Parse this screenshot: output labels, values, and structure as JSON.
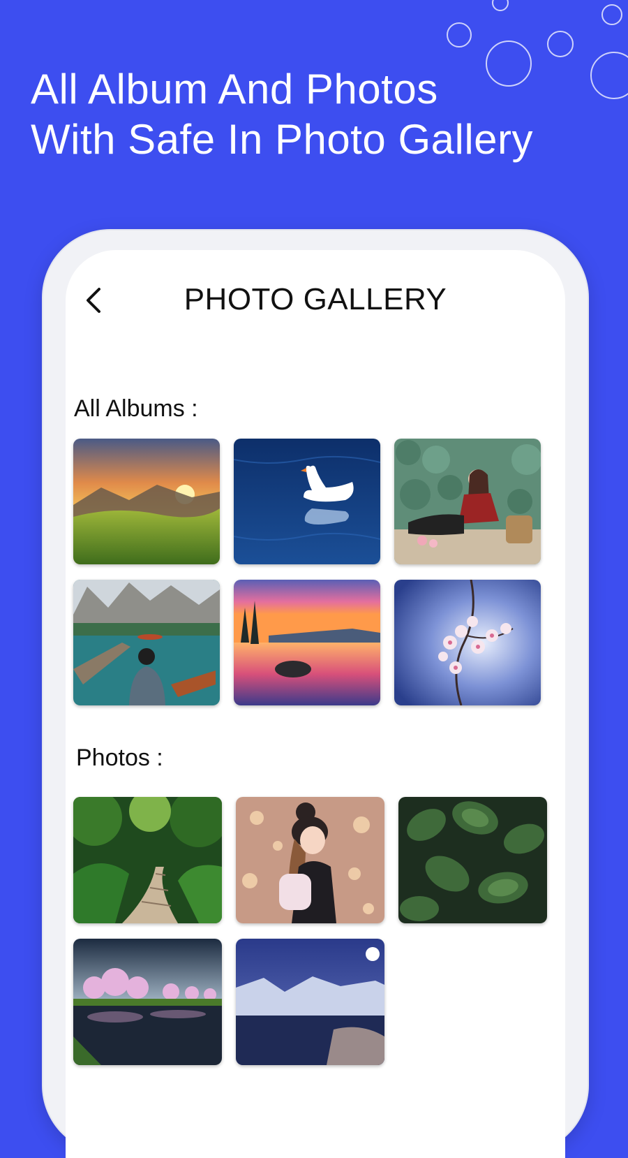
{
  "promo": {
    "headline_line1": "All Album And Photos",
    "headline_line2": "With Safe In Photo Gallery"
  },
  "colors": {
    "background": "#3d4ef0",
    "accent_white": "#ffffff",
    "title_text": "#111111"
  },
  "app": {
    "title": "PHOTO GALLERY",
    "back_icon": "chevron-left-icon"
  },
  "albums": {
    "section_label": "All Albums :",
    "items": [
      {
        "image": "mountain-sunset-meadow"
      },
      {
        "image": "white-swan-on-lake"
      },
      {
        "image": "woman-in-lotus-field"
      },
      {
        "image": "man-on-dock-mountain-lake"
      },
      {
        "image": "pink-sunset-lake"
      },
      {
        "image": "cherry-blossom-branch"
      }
    ]
  },
  "photos": {
    "section_label": "Photos :",
    "items": [
      {
        "image": "forest-wooden-path"
      },
      {
        "image": "illustrated-girl-with-backpack"
      },
      {
        "image": "green-leaves-with-raindrops"
      },
      {
        "image": "pink-trees-by-lake"
      },
      {
        "image": "snowy-mountain-night-lake"
      }
    ]
  }
}
